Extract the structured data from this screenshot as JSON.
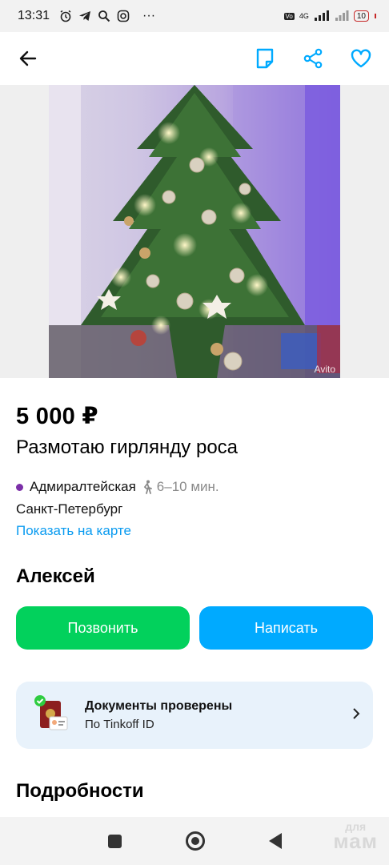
{
  "status_bar": {
    "time": "13:31",
    "more": "···",
    "network": "4G",
    "battery": "10"
  },
  "listing": {
    "watermark": "Avito",
    "price": "5 000 ₽",
    "title": "Размотаю гирлянду роса",
    "metro_station": "Адмиралтейская",
    "walk_time": "6–10 мин.",
    "city": "Санкт-Петербург",
    "map_link": "Показать на карте"
  },
  "seller": {
    "name": "Алексей",
    "call_label": "Позвонить",
    "message_label": "Написать"
  },
  "documents": {
    "title": "Документы проверены",
    "subtitle": "По Tinkoff ID"
  },
  "details_heading": "Подробности",
  "brand_overlay": {
    "line1": "для",
    "line2": "мам"
  },
  "colors": {
    "accent_blue": "#00aaff",
    "call_green": "#02d15c",
    "link_blue": "#0a9bf0",
    "metro_dot": "#7b2fa8"
  },
  "icons": {
    "back": "arrow-left-icon",
    "notes": "note-icon",
    "share": "share-icon",
    "favorite": "heart-icon"
  }
}
